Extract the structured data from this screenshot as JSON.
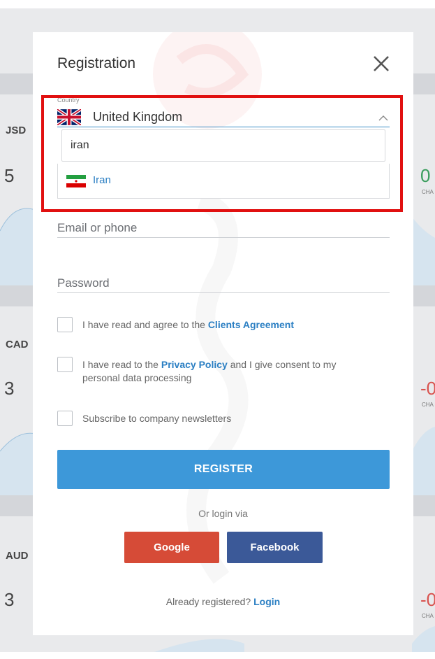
{
  "background": {
    "pairs": [
      {
        "label": "JSD",
        "value": "5",
        "right_value": "0",
        "right_color": "#3a9d5d",
        "right_caption": "CHA"
      },
      {
        "label": "CAD",
        "value": "3",
        "right_value": "-0",
        "right_color": "#d9534f",
        "right_caption": "CHA"
      },
      {
        "label": "AUD",
        "value": "3",
        "right_value": "-0",
        "right_color": "#d9534f",
        "right_caption": "CHA"
      }
    ]
  },
  "modal": {
    "title": "Registration",
    "close_icon": "close-icon",
    "country": {
      "label": "Country",
      "selected_value": "United Kingdom",
      "selected_flag": "uk-flag-icon",
      "search_value": "iran",
      "options": [
        {
          "label": "Iran",
          "flag": "iran-flag-icon"
        }
      ]
    },
    "email_placeholder": "Email or phone",
    "password_placeholder": "Password",
    "agreement": {
      "prefix": "I have read and agree to the ",
      "link": "Clients Agreement"
    },
    "privacy": {
      "prefix": "I have read to the ",
      "link": "Privacy Policy",
      "suffix": " and I give consent to my personal data processing"
    },
    "newsletter": "Subscribe to company newsletters",
    "register_label": "REGISTER",
    "or_login": "Or login via",
    "google_label": "Google",
    "facebook_label": "Facebook",
    "already_text": "Already registered? ",
    "login_link": "Login"
  },
  "colors": {
    "accent": "#3d98d9",
    "link": "#2b7fc3",
    "google": "#d64b37",
    "facebook": "#3b5998",
    "highlight": "#e11010"
  }
}
